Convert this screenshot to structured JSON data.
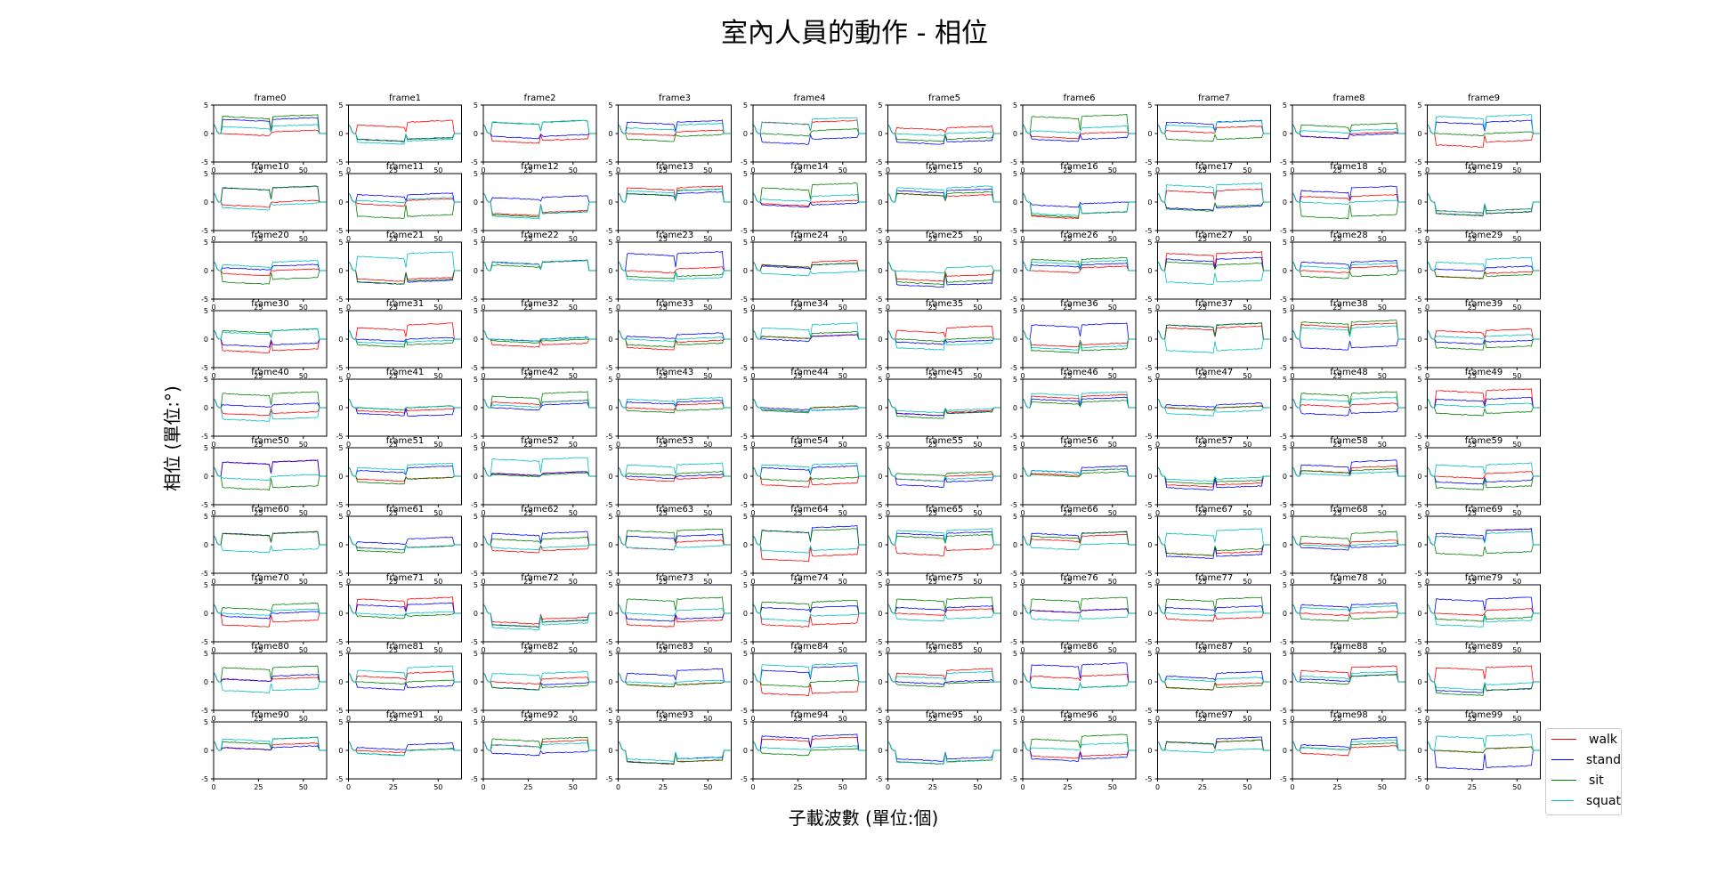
{
  "chart_data": {
    "type": "line",
    "title": "室內人員的動作 - 相位",
    "xlabel": "子載波數 (單位:個)",
    "ylabel": "相位 (單位:°)",
    "xlim": [
      0,
      63
    ],
    "ylim": [
      -5,
      5
    ],
    "xticks": [
      "0",
      "25",
      "50"
    ],
    "yticks": [
      "5",
      "0",
      "-5"
    ],
    "legend_position": "bottom-right",
    "series": [
      {
        "name": "walk",
        "color": "#ff0000"
      },
      {
        "name": "stand",
        "color": "#0000ff"
      },
      {
        "name": "sit",
        "color": "#008000"
      },
      {
        "name": "squat",
        "color": "#00bfbf"
      }
    ],
    "value_format": "per frame: [walk_left, walk_right, stand_left, stand_right, sit_left, sit_right, squat_left, squat_right] approximate phase level of each half of the subcarriers",
    "frames": [
      {
        "t": "frame0",
        "v": [
          0,
          0.3,
          2.5,
          2.5,
          3,
          3,
          1.2,
          1.3
        ]
      },
      {
        "t": "frame1",
        "v": [
          1.5,
          2,
          -1,
          -1,
          -1,
          -1,
          -1.5,
          -1.3
        ]
      },
      {
        "t": "frame2",
        "v": [
          -1.3,
          -1.2,
          -0.5,
          -0.5,
          2,
          2,
          2,
          2
        ]
      },
      {
        "t": "frame3",
        "v": [
          0,
          0.3,
          2,
          2,
          -1,
          -0.5,
          1,
          1.5
        ]
      },
      {
        "t": "frame4",
        "v": [
          2,
          2,
          -1.5,
          -1,
          0,
          0.5,
          2,
          2.5
        ]
      },
      {
        "t": "frame5",
        "v": [
          1,
          1,
          -1.5,
          -1.5,
          -1,
          -1,
          0,
          0
        ]
      },
      {
        "t": "frame6",
        "v": [
          -0.5,
          0,
          -1,
          -1,
          3,
          3,
          0.5,
          1
        ]
      },
      {
        "t": "frame7",
        "v": [
          0.5,
          1,
          2,
          2,
          -1,
          -1,
          1.5,
          2
        ]
      },
      {
        "t": "frame8",
        "v": [
          -0.5,
          0,
          -0.5,
          -0.3,
          1.5,
          1.5,
          0.5,
          0.5
        ]
      },
      {
        "t": "frame9",
        "v": [
          -2,
          -1.5,
          2,
          2,
          0,
          0,
          3,
          3
        ]
      },
      {
        "t": "frame10",
        "v": [
          -0.5,
          0,
          2.5,
          2.5,
          2.5,
          2.5,
          -1,
          -0.5
        ]
      },
      {
        "t": "frame11",
        "v": [
          -0.3,
          0.3,
          1.3,
          1.3,
          -2.5,
          -2.5,
          0.3,
          0.5
        ]
      },
      {
        "t": "frame12",
        "v": [
          -2,
          -1.8,
          0.8,
          0.8,
          -2.2,
          -2,
          -2.5,
          -2
        ]
      },
      {
        "t": "frame13",
        "v": [
          2.5,
          2.5,
          1.5,
          1.5,
          1.5,
          2,
          2,
          2
        ]
      },
      {
        "t": "frame14",
        "v": [
          -0.3,
          0,
          -0.5,
          -0.5,
          2.5,
          3,
          0.5,
          1
        ]
      },
      {
        "t": "frame15",
        "v": [
          1.5,
          1,
          2,
          2,
          1.5,
          1.5,
          2.5,
          2.5
        ]
      },
      {
        "t": "frame16",
        "v": [
          -2.5,
          -2,
          -0.5,
          -0.3,
          -2.3,
          -2,
          -2,
          -2
        ]
      },
      {
        "t": "frame17",
        "v": [
          2,
          2,
          -1,
          -1,
          -1.2,
          -0.8,
          3,
          3
        ]
      },
      {
        "t": "frame18",
        "v": [
          1,
          1,
          2,
          2.5,
          -2.5,
          -2.5,
          0,
          0
        ]
      },
      {
        "t": "frame19",
        "v": [
          -1.5,
          -1.5,
          -2,
          -2,
          -2,
          -2,
          -1.5,
          -1.5
        ]
      },
      {
        "t": "frame20",
        "v": [
          -0.5,
          0,
          0.5,
          0.8,
          -2,
          -1.5,
          1,
          1.5
        ]
      },
      {
        "t": "frame21",
        "v": [
          -1.5,
          -1.5,
          -2,
          -2,
          -2,
          -1.8,
          2.5,
          3
        ]
      },
      {
        "t": "frame22",
        "v": [
          1.5,
          1.5,
          1.5,
          1.5,
          1,
          1.5,
          1.5,
          1.5
        ]
      },
      {
        "t": "frame23",
        "v": [
          0,
          0.3,
          3,
          3,
          -1,
          -1,
          -1.5,
          -1.5
        ]
      },
      {
        "t": "frame24",
        "v": [
          1,
          1.5,
          0.8,
          1,
          1,
          1,
          -0.5,
          -0.5
        ]
      },
      {
        "t": "frame25",
        "v": [
          -1.5,
          -1,
          -2.5,
          -2.5,
          -2,
          -2,
          0,
          0.5
        ]
      },
      {
        "t": "frame26",
        "v": [
          0,
          0.5,
          1,
          1,
          2,
          2,
          1.5,
          1.5
        ]
      },
      {
        "t": "frame27",
        "v": [
          3,
          3,
          2,
          2,
          1.5,
          1,
          -2,
          -2
        ]
      },
      {
        "t": "frame28",
        "v": [
          0,
          0.5,
          1.5,
          1.5,
          -1,
          -1,
          0.8,
          1
        ]
      },
      {
        "t": "frame29",
        "v": [
          -1,
          -0.5,
          0.3,
          0.5,
          -1,
          -1,
          1.5,
          2
        ]
      },
      {
        "t": "frame30",
        "v": [
          -2,
          -2,
          -1,
          -1,
          1.5,
          1.5,
          1.2,
          1.5
        ]
      },
      {
        "t": "frame31",
        "v": [
          2,
          2.5,
          0,
          0,
          -1,
          -1,
          -0.5,
          -0.5
        ]
      },
      {
        "t": "frame32",
        "v": [
          -1,
          -1,
          0,
          0,
          -0.3,
          -0.3,
          0,
          0
        ]
      },
      {
        "t": "frame33",
        "v": [
          -1.5,
          -0.5,
          0.5,
          0.8,
          -1,
          -1,
          0,
          0
        ]
      },
      {
        "t": "frame34",
        "v": [
          0.5,
          0.5,
          0,
          0.5,
          0.5,
          1,
          2,
          2.5
        ]
      },
      {
        "t": "frame35",
        "v": [
          1.5,
          2,
          -0.5,
          -0.5,
          0,
          0,
          -1.5,
          -1
        ]
      },
      {
        "t": "frame36",
        "v": [
          -1,
          -1,
          2.5,
          2.5,
          -2,
          -2,
          -1.5,
          -1.5
        ]
      },
      {
        "t": "frame37",
        "v": [
          2,
          2,
          2.5,
          2.5,
          2.5,
          2.5,
          -2,
          -2
        ]
      },
      {
        "t": "frame38",
        "v": [
          2.5,
          2.5,
          -1.5,
          -1.5,
          3,
          3,
          2,
          2
        ]
      },
      {
        "t": "frame39",
        "v": [
          1.5,
          1.5,
          -0.5,
          -0.5,
          -1.5,
          -1.5,
          0.5,
          0.5
        ]
      },
      {
        "t": "frame40",
        "v": [
          -1,
          -1,
          0.5,
          0.5,
          2.5,
          2.5,
          -2,
          -2
        ]
      },
      {
        "t": "frame41",
        "v": [
          -0.5,
          -0.5,
          -1,
          -1.5,
          0,
          0,
          0,
          0
        ]
      },
      {
        "t": "frame42",
        "v": [
          1,
          1,
          0,
          0.5,
          2,
          2.5,
          0.5,
          1
        ]
      },
      {
        "t": "frame43",
        "v": [
          0,
          0.5,
          1,
          1,
          -0.5,
          -0.5,
          1.5,
          1.5
        ]
      },
      {
        "t": "frame44",
        "v": [
          -0.5,
          0,
          0,
          -0.5,
          -0.3,
          0,
          -0.5,
          -0.5
        ]
      },
      {
        "t": "frame45",
        "v": [
          -1,
          -0.8,
          -1,
          -1,
          -1.5,
          -1,
          -0.5,
          -0.5
        ]
      },
      {
        "t": "frame46",
        "v": [
          2,
          2,
          1.5,
          1.5,
          1,
          1,
          2.5,
          2.5
        ]
      },
      {
        "t": "frame47",
        "v": [
          0,
          0,
          0.5,
          0.5,
          0,
          0,
          -1,
          -0.8
        ]
      },
      {
        "t": "frame48",
        "v": [
          0.5,
          0.5,
          -1,
          -1,
          2.5,
          2.5,
          1.5,
          1.5
        ]
      },
      {
        "t": "frame49",
        "v": [
          3,
          3,
          1.5,
          1.5,
          -1,
          -1,
          0.5,
          0.5
        ]
      },
      {
        "t": "frame50",
        "v": [
          2.5,
          2.5,
          2.5,
          2.5,
          -2,
          -2,
          -0.3,
          0
        ]
      },
      {
        "t": "frame51",
        "v": [
          -0.5,
          -0.5,
          1,
          1.5,
          -1,
          -0.5,
          1.5,
          2
        ]
      },
      {
        "t": "frame52",
        "v": [
          0.5,
          0.5,
          0.5,
          0.5,
          0.3,
          0.3,
          3,
          3
        ]
      },
      {
        "t": "frame53",
        "v": [
          -0.5,
          -0.5,
          0,
          0,
          0.5,
          0.5,
          2,
          2
        ]
      },
      {
        "t": "frame54",
        "v": [
          -1.5,
          -1.5,
          1.5,
          1.5,
          -0.5,
          -0.5,
          2,
          2
        ]
      },
      {
        "t": "frame55",
        "v": [
          -0.5,
          0,
          -1.5,
          -1,
          0.5,
          0.5,
          -0.5,
          -0.5
        ]
      },
      {
        "t": "frame56",
        "v": [
          0.5,
          1,
          1,
          1.5,
          0.3,
          0.5,
          1,
          1
        ]
      },
      {
        "t": "frame57",
        "v": [
          -1.5,
          -1.5,
          -2,
          -2,
          -1,
          -1,
          -0.5,
          -0.5
        ]
      },
      {
        "t": "frame58",
        "v": [
          1,
          1.5,
          2,
          2.5,
          1,
          1,
          0.5,
          0.5
        ]
      },
      {
        "t": "frame59",
        "v": [
          0,
          0.5,
          -1,
          -1,
          -2,
          -2,
          2,
          2
        ]
      },
      {
        "t": "frame60",
        "v": [
          2,
          2,
          2,
          2,
          2,
          2,
          -1,
          -1
        ]
      },
      {
        "t": "frame61",
        "v": [
          -0.5,
          -0.5,
          0.5,
          1,
          -1,
          -0.5,
          -0.5,
          -0.5
        ]
      },
      {
        "t": "frame62",
        "v": [
          -1,
          -1,
          2,
          2,
          1,
          1,
          -0.5,
          -0.5
        ]
      },
      {
        "t": "frame63",
        "v": [
          -0.5,
          0.5,
          1.5,
          1.5,
          2.5,
          2.5,
          -0.5,
          -0.5
        ]
      },
      {
        "t": "frame64",
        "v": [
          -2.5,
          -2,
          2.5,
          3,
          2.5,
          2.5,
          -1,
          -1
        ]
      },
      {
        "t": "frame65",
        "v": [
          -1.5,
          -1,
          2,
          2,
          1.5,
          1.5,
          2.5,
          2.5
        ]
      },
      {
        "t": "frame66",
        "v": [
          1,
          1.5,
          2,
          2,
          1.5,
          2,
          -0.5,
          0
        ]
      },
      {
        "t": "frame67",
        "v": [
          -1.5,
          -1.5,
          -2,
          -2,
          -1.5,
          -1,
          2,
          2.5
        ]
      },
      {
        "t": "frame68",
        "v": [
          0.3,
          0.5,
          -0.5,
          -0.5,
          1.5,
          2,
          0,
          0
        ]
      },
      {
        "t": "frame69",
        "v": [
          1.5,
          2.5,
          2,
          2.5,
          -1.5,
          -1.5,
          1.5,
          2
        ]
      },
      {
        "t": "frame70",
        "v": [
          -2,
          -1.5,
          -0.5,
          0,
          1,
          1.5,
          0,
          0.5
        ]
      },
      {
        "t": "frame71",
        "v": [
          2.5,
          2.5,
          1.5,
          1.5,
          -0.5,
          -0.5,
          0,
          0
        ]
      },
      {
        "t": "frame72",
        "v": [
          -1.5,
          -1,
          -2,
          -1.5,
          -2,
          -1.5,
          -2.5,
          -2
        ]
      },
      {
        "t": "frame73",
        "v": [
          -2,
          -1.5,
          -1,
          -1,
          2.5,
          2.5,
          0,
          0.5
        ]
      },
      {
        "t": "frame74",
        "v": [
          -2,
          -2,
          1,
          1,
          2,
          2,
          -1,
          -0.5
        ]
      },
      {
        "t": "frame75",
        "v": [
          0,
          0.5,
          1,
          1,
          2.5,
          2.5,
          -1,
          -1
        ]
      },
      {
        "t": "frame76",
        "v": [
          0.5,
          0.5,
          0.5,
          0.5,
          2.5,
          2.5,
          -1,
          -1
        ]
      },
      {
        "t": "frame77",
        "v": [
          -1,
          -1,
          1,
          1,
          2.5,
          2.5,
          0,
          0
        ]
      },
      {
        "t": "frame78",
        "v": [
          0,
          0,
          1.5,
          1.5,
          -1,
          -1,
          1,
          1
        ]
      },
      {
        "t": "frame79",
        "v": [
          0,
          0.5,
          2.5,
          2.5,
          -1,
          -1,
          -2,
          -1.5
        ]
      },
      {
        "t": "frame80",
        "v": [
          0.5,
          0.5,
          0.5,
          1,
          2.5,
          2.5,
          -1.5,
          -1.5
        ]
      },
      {
        "t": "frame81",
        "v": [
          1,
          1.5,
          -1,
          -1,
          0,
          0,
          2,
          2.5
        ]
      },
      {
        "t": "frame82",
        "v": [
          0,
          0.5,
          -1,
          -0.5,
          -1,
          -1,
          1.5,
          1.5
        ]
      },
      {
        "t": "frame83",
        "v": [
          -0.5,
          -0.5,
          1.5,
          2,
          -0.5,
          -0.5,
          0,
          0
        ]
      },
      {
        "t": "frame84",
        "v": [
          -2,
          -2,
          2,
          2.5,
          -0.5,
          0,
          3,
          3
        ]
      },
      {
        "t": "frame85",
        "v": [
          1.5,
          2,
          0,
          0,
          -0.5,
          -0.3,
          1,
          1.5
        ]
      },
      {
        "t": "frame86",
        "v": [
          1,
          1,
          3,
          3,
          -1,
          -1,
          -1,
          -1
        ]
      },
      {
        "t": "frame87",
        "v": [
          -1,
          -0.5,
          1,
          1.5,
          -1,
          -1,
          0.5,
          0.5
        ]
      },
      {
        "t": "frame88",
        "v": [
          2,
          2.5,
          0.5,
          1,
          0,
          1,
          1,
          1.5
        ]
      },
      {
        "t": "frame89",
        "v": [
          2.5,
          2.5,
          -1.5,
          -1.5,
          -2,
          -1.5,
          -1,
          -0.5
        ]
      },
      {
        "t": "frame90",
        "v": [
          0.5,
          1,
          0.5,
          0.5,
          1.5,
          2,
          2,
          2
        ]
      },
      {
        "t": "frame91",
        "v": [
          0,
          0,
          0.5,
          1,
          -0.5,
          0,
          -0.5,
          0
        ]
      },
      {
        "t": "frame92",
        "v": [
          1,
          1.5,
          -0.5,
          -0.5,
          2,
          2,
          1,
          1
        ]
      },
      {
        "t": "frame93",
        "v": [
          -2,
          -2,
          -2,
          -1.5,
          -2,
          -2,
          -1.5,
          -1.5
        ]
      },
      {
        "t": "frame94",
        "v": [
          2,
          2,
          2.5,
          2.5,
          -0.5,
          0,
          0.5,
          0.5
        ]
      },
      {
        "t": "frame95",
        "v": [
          -2,
          -2,
          -1.5,
          -1.5,
          -2,
          -2,
          -2,
          -2
        ]
      },
      {
        "t": "frame96",
        "v": [
          -1,
          -1,
          -1.5,
          -1.5,
          2,
          2.5,
          0.5,
          1
        ]
      },
      {
        "t": "frame97",
        "v": [
          1.5,
          1.5,
          1.5,
          2,
          1.5,
          1.5,
          0,
          0
        ]
      },
      {
        "t": "frame98",
        "v": [
          -0.5,
          0.5,
          1,
          2,
          0.5,
          1,
          0.5,
          1.5
        ]
      },
      {
        "t": "frame99",
        "v": [
          0,
          0.3,
          -3,
          -3,
          0,
          0.3,
          2.5,
          2.5
        ]
      }
    ]
  }
}
